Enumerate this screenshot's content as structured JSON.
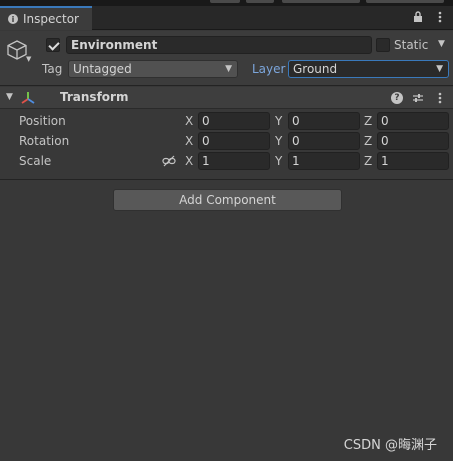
{
  "tab": {
    "icon": "info-icon",
    "label": "Inspector"
  },
  "tabbar_icons": [
    "lock-icon",
    "kebab-menu-icon"
  ],
  "gameobject": {
    "icon": "cube-icon",
    "active_checked": true,
    "name": "Environment",
    "static_checked": false,
    "static_label": "Static",
    "tag_label": "Tag",
    "tag_value": "Untagged",
    "layer_label": "Layer",
    "layer_value": "Ground"
  },
  "transform": {
    "icon": "transform-axes-icon",
    "title": "Transform",
    "header_icons": [
      "help-icon",
      "preset-sliders-icon",
      "kebab-menu-icon"
    ],
    "rows": [
      {
        "label": "Position",
        "x_label": "X",
        "x": "0",
        "y_label": "Y",
        "y": "0",
        "z_label": "Z",
        "z": "0"
      },
      {
        "label": "Rotation",
        "x_label": "X",
        "x": "0",
        "y_label": "Y",
        "y": "0",
        "z_label": "Z",
        "z": "0"
      },
      {
        "label": "Scale",
        "x_label": "X",
        "x": "1",
        "y_label": "Y",
        "y": "1",
        "z_label": "Z",
        "z": "1"
      }
    ]
  },
  "add_component_label": "Add Component",
  "watermark": "CSDN @晦渊子",
  "colors": {
    "accent": "#3a79bb",
    "background": "#383838",
    "panel": "#3c3c3c"
  }
}
